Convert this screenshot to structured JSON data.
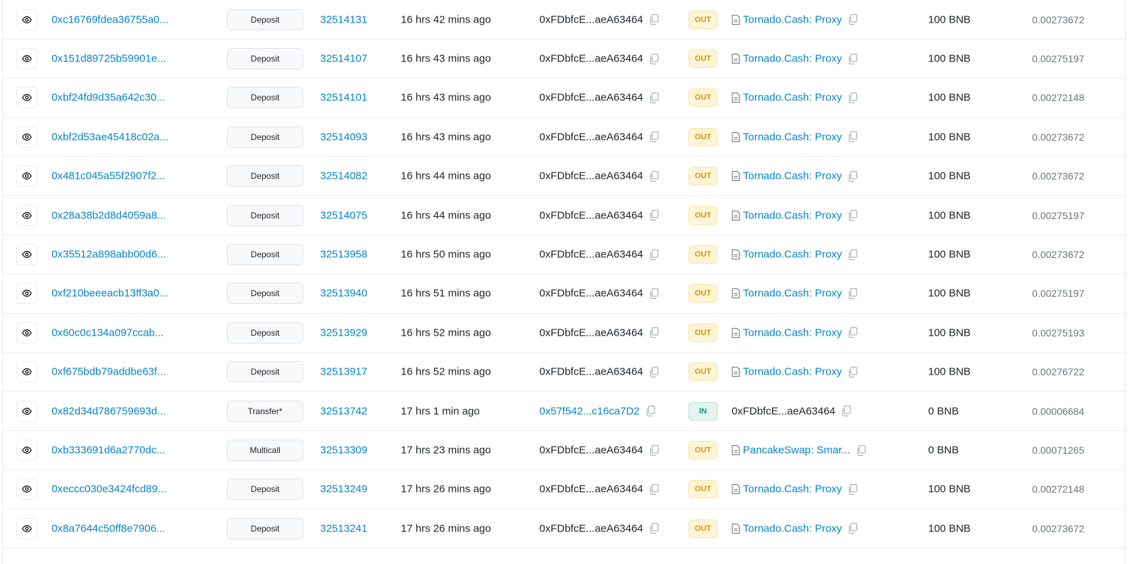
{
  "rows": [
    {
      "hash": "0xc16769fdea36755a0...",
      "method": "Deposit",
      "block": "32514131",
      "age": "16 hrs 42 mins ago",
      "from": "0xFDbfcE...aeA63464",
      "from_link": false,
      "dir": "OUT",
      "to": "Tornado.Cash: Proxy",
      "to_contract": true,
      "to_link": true,
      "value": "100 BNB",
      "fee": "0.00273672"
    },
    {
      "hash": "0x151d89725b59901e...",
      "method": "Deposit",
      "block": "32514107",
      "age": "16 hrs 43 mins ago",
      "from": "0xFDbfcE...aeA63464",
      "from_link": false,
      "dir": "OUT",
      "to": "Tornado.Cash: Proxy",
      "to_contract": true,
      "to_link": true,
      "value": "100 BNB",
      "fee": "0.00275197"
    },
    {
      "hash": "0xbf24fd9d35a642c30...",
      "method": "Deposit",
      "block": "32514101",
      "age": "16 hrs 43 mins ago",
      "from": "0xFDbfcE...aeA63464",
      "from_link": false,
      "dir": "OUT",
      "to": "Tornado.Cash: Proxy",
      "to_contract": true,
      "to_link": true,
      "value": "100 BNB",
      "fee": "0.00272148"
    },
    {
      "hash": "0xbf2d53ae45418c02a...",
      "method": "Deposit",
      "block": "32514093",
      "age": "16 hrs 43 mins ago",
      "from": "0xFDbfcE...aeA63464",
      "from_link": false,
      "dir": "OUT",
      "to": "Tornado.Cash: Proxy",
      "to_contract": true,
      "to_link": true,
      "value": "100 BNB",
      "fee": "0.00273672"
    },
    {
      "hash": "0x481c045a55f2907f2...",
      "method": "Deposit",
      "block": "32514082",
      "age": "16 hrs 44 mins ago",
      "from": "0xFDbfcE...aeA63464",
      "from_link": false,
      "dir": "OUT",
      "to": "Tornado.Cash: Proxy",
      "to_contract": true,
      "to_link": true,
      "value": "100 BNB",
      "fee": "0.00273672"
    },
    {
      "hash": "0x28a38b2d8d4059a8...",
      "method": "Deposit",
      "block": "32514075",
      "age": "16 hrs 44 mins ago",
      "from": "0xFDbfcE...aeA63464",
      "from_link": false,
      "dir": "OUT",
      "to": "Tornado.Cash: Proxy",
      "to_contract": true,
      "to_link": true,
      "value": "100 BNB",
      "fee": "0.00275197"
    },
    {
      "hash": "0x35512a898abb00d6...",
      "method": "Deposit",
      "block": "32513958",
      "age": "16 hrs 50 mins ago",
      "from": "0xFDbfcE...aeA63464",
      "from_link": false,
      "dir": "OUT",
      "to": "Tornado.Cash: Proxy",
      "to_contract": true,
      "to_link": true,
      "value": "100 BNB",
      "fee": "0.00273672"
    },
    {
      "hash": "0xf210beeeacb13ff3a0...",
      "method": "Deposit",
      "block": "32513940",
      "age": "16 hrs 51 mins ago",
      "from": "0xFDbfcE...aeA63464",
      "from_link": false,
      "dir": "OUT",
      "to": "Tornado.Cash: Proxy",
      "to_contract": true,
      "to_link": true,
      "value": "100 BNB",
      "fee": "0.00275197"
    },
    {
      "hash": "0x60c0c134a097ccab...",
      "method": "Deposit",
      "block": "32513929",
      "age": "16 hrs 52 mins ago",
      "from": "0xFDbfcE...aeA63464",
      "from_link": false,
      "dir": "OUT",
      "to": "Tornado.Cash: Proxy",
      "to_contract": true,
      "to_link": true,
      "value": "100 BNB",
      "fee": "0.00275193"
    },
    {
      "hash": "0xf675bdb79addbe63f...",
      "method": "Deposit",
      "block": "32513917",
      "age": "16 hrs 52 mins ago",
      "from": "0xFDbfcE...aeA63464",
      "from_link": false,
      "dir": "OUT",
      "to": "Tornado.Cash: Proxy",
      "to_contract": true,
      "to_link": true,
      "value": "100 BNB",
      "fee": "0.00276722"
    },
    {
      "hash": "0x82d34d786759693d...",
      "method": "Transfer*",
      "block": "32513742",
      "age": "17 hrs 1 min ago",
      "from": "0x57f542...c16ca7D2",
      "from_link": true,
      "dir": "IN",
      "to": "0xFDbfcE...aeA63464",
      "to_contract": false,
      "to_link": false,
      "value": "0 BNB",
      "fee": "0.00006684"
    },
    {
      "hash": "0xb333691d6a2770dc...",
      "method": "Multicall",
      "block": "32513309",
      "age": "17 hrs 23 mins ago",
      "from": "0xFDbfcE...aeA63464",
      "from_link": false,
      "dir": "OUT",
      "to": "PancakeSwap: Smar...",
      "to_contract": true,
      "to_link": true,
      "value": "0 BNB",
      "fee": "0.00071265"
    },
    {
      "hash": "0xeccc030e3424fcd89...",
      "method": "Deposit",
      "block": "32513249",
      "age": "17 hrs 26 mins ago",
      "from": "0xFDbfcE...aeA63464",
      "from_link": false,
      "dir": "OUT",
      "to": "Tornado.Cash: Proxy",
      "to_contract": true,
      "to_link": true,
      "value": "100 BNB",
      "fee": "0.00272148"
    },
    {
      "hash": "0x8a7644c50ff8e7906...",
      "method": "Deposit",
      "block": "32513241",
      "age": "17 hrs 26 mins ago",
      "from": "0xFDbfcE...aeA63464",
      "from_link": false,
      "dir": "OUT",
      "to": "Tornado.Cash: Proxy",
      "to_contract": true,
      "to_link": true,
      "value": "100 BNB",
      "fee": "0.00273672"
    }
  ]
}
